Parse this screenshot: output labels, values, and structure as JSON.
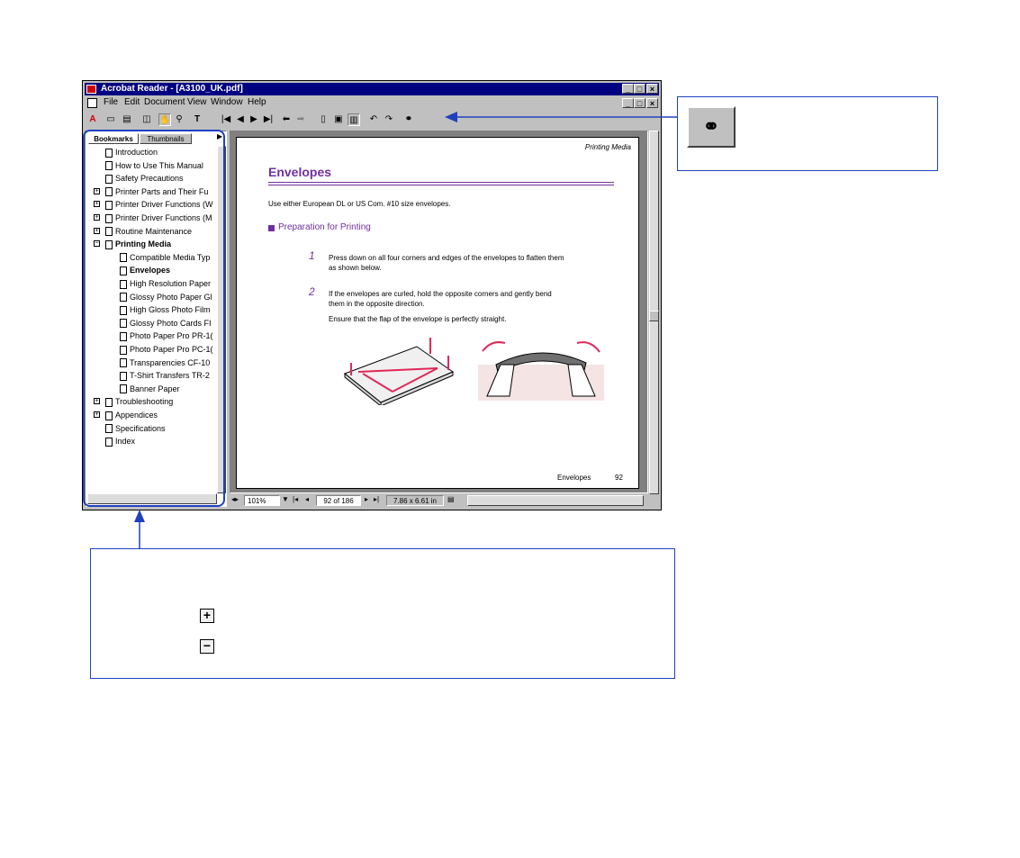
{
  "window": {
    "title": "Acrobat Reader - [A3100_UK.pdf]",
    "menu": [
      "File",
      "Edit",
      "Document",
      "View",
      "Window",
      "Help"
    ],
    "minimize_glyph": "_",
    "maximize_glyph": "□",
    "close_glyph": "×"
  },
  "toolbar": {
    "icons": [
      "acrobat-logo-icon",
      "open-icon",
      "print-icon",
      "show-navigation-icon",
      "hand-tool-icon",
      "zoom-tool-icon",
      "text-select-icon",
      "first-page-icon",
      "previous-page-icon",
      "next-page-icon",
      "last-page-icon",
      "go-back-icon",
      "go-forward-icon",
      "actual-size-icon",
      "fit-page-icon",
      "fit-width-icon",
      "rotate-left-icon",
      "rotate-right-icon",
      "find-icon"
    ]
  },
  "nav": {
    "tabs": [
      "Bookmarks",
      "Thumbnails"
    ],
    "bookmarks": [
      {
        "label": "Introduction",
        "level": 0,
        "toggle": ""
      },
      {
        "label": "How to Use This Manual",
        "level": 0,
        "toggle": ""
      },
      {
        "label": "Safety Precautions",
        "level": 0,
        "toggle": ""
      },
      {
        "label": "Printer Parts and Their Fu",
        "level": 0,
        "toggle": "+"
      },
      {
        "label": "Printer Driver Functions (W",
        "level": 0,
        "toggle": "+"
      },
      {
        "label": "Printer Driver Functions (M",
        "level": 0,
        "toggle": "+"
      },
      {
        "label": "Routine Maintenance",
        "level": 0,
        "toggle": "+"
      },
      {
        "label": "Printing Media",
        "level": 0,
        "toggle": "−",
        "bold": true
      },
      {
        "label": "Compatible Media Typ",
        "level": 1,
        "toggle": ""
      },
      {
        "label": "Envelopes",
        "level": 1,
        "toggle": "",
        "bold": true
      },
      {
        "label": "High Resolution Paper",
        "level": 1,
        "toggle": ""
      },
      {
        "label": "Glossy Photo Paper Gl",
        "level": 1,
        "toggle": ""
      },
      {
        "label": "High Gloss Photo Film",
        "level": 1,
        "toggle": ""
      },
      {
        "label": "Glossy Photo Cards FI",
        "level": 1,
        "toggle": ""
      },
      {
        "label": "Photo Paper Pro PR-1(",
        "level": 1,
        "toggle": ""
      },
      {
        "label": "Photo Paper Pro PC-1(",
        "level": 1,
        "toggle": ""
      },
      {
        "label": "Transparencies CF-10",
        "level": 1,
        "toggle": ""
      },
      {
        "label": "T-Shirt Transfers TR-2",
        "level": 1,
        "toggle": ""
      },
      {
        "label": "Banner Paper",
        "level": 1,
        "toggle": ""
      },
      {
        "label": "Troubleshooting",
        "level": 0,
        "toggle": "+"
      },
      {
        "label": "Appendices",
        "level": 0,
        "toggle": "+"
      },
      {
        "label": "Specifications",
        "level": 0,
        "toggle": ""
      },
      {
        "label": "Index",
        "level": 0,
        "toggle": ""
      }
    ]
  },
  "document": {
    "running_head": "Printing Media",
    "title": "Envelopes",
    "intro": "Use either European DL or US Com. #10 size envelopes.",
    "section": "Preparation for Printing",
    "step1_num": "1",
    "step1_text_a": "Press down on all four corners and edges of the envelopes to flatten them",
    "step1_text_b": "as shown below.",
    "step2_num": "2",
    "step2_text_a": "If the envelopes are curled, hold the opposite corners and gently bend",
    "step2_text_b": "them in the opposite direction.",
    "step2_note": "Ensure that the flap of the envelope is perfectly straight.",
    "footer_label": "Envelopes",
    "footer_page": "92"
  },
  "status": {
    "zoom": "101%",
    "page": "92 of 186",
    "size": "7.86 x 6.61 in"
  },
  "colors": {
    "accent_purple": "#7030a0",
    "callout_blue": "#2040c0",
    "arrow_pink": "#e0285a",
    "titlebar": "#000080"
  }
}
